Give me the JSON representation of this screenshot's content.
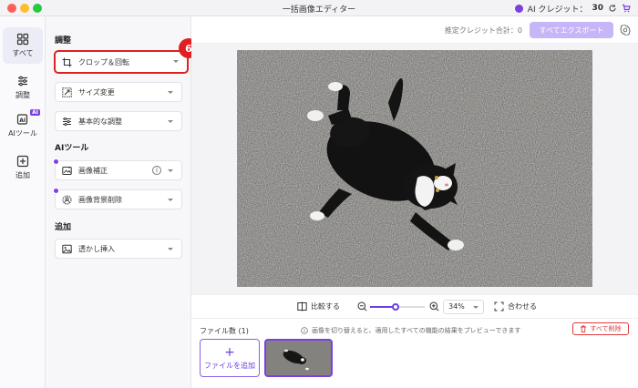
{
  "window": {
    "title": "一括画像エディター",
    "credits_label": "AI クレジット：",
    "credits_value": "30"
  },
  "rail": {
    "items": [
      {
        "label": "すべて",
        "icon": "grid-icon"
      },
      {
        "label": "調整",
        "icon": "sliders-icon"
      },
      {
        "label": "AIツール",
        "icon": "ai-tool-icon",
        "badge": "AI"
      },
      {
        "label": "追加",
        "icon": "plus-box-icon"
      }
    ]
  },
  "panel": {
    "section_adjust": "調整",
    "section_ai": "AIツール",
    "section_add": "追加",
    "tools": {
      "crop": "クロップ＆回転",
      "resize": "サイズ変更",
      "basic": "基本的な調整",
      "enhance": "画像補正",
      "bg_remove": "画像背景削除",
      "watermark": "透かし挿入"
    },
    "step_number": "6",
    "info_glyph": "i"
  },
  "toolbar": {
    "estimate_label": "推定クレジット合計：",
    "estimate_value": "0",
    "export_all": "すべてエクスポート"
  },
  "zoom": {
    "compare": "比較する",
    "value": "34%",
    "level": 0.34,
    "fit": "合わせる"
  },
  "files": {
    "count_label": "ファイル数 (1)",
    "hint": "画像を切り替えると、適用したすべての機能の結果をプレビューできます",
    "delete_all": "すべて削除",
    "add_file": "ファイルを追加",
    "add_plus": "+"
  },
  "colors": {
    "accent": "#7b3fe4",
    "highlight": "#e02020",
    "export_disabled": "#c7b6f7",
    "danger": "#e03a3a"
  }
}
